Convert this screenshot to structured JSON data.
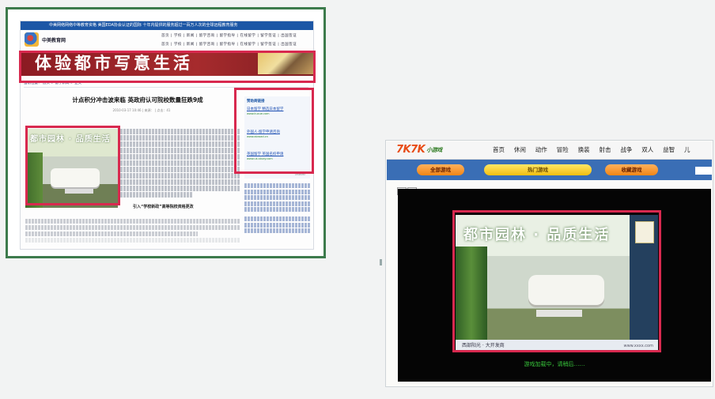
{
  "left": {
    "topbar_text": "中美网络网络中等教育资格 美国EDA协会认证的国际 十年内提供的服务超过一百万人次的全球远程教育服务",
    "logo_text": "中美教育网",
    "nav_rows": [
      "首页 | 学校 | 新闻 | 留学咨询 | 留学指导 | 在线留学 | 留学签证 | 出国签证",
      "首页 | 学校 | 新闻 | 留学咨询 | 留学指导 | 在线留学 | 留学签证 | 出国签证"
    ],
    "banner_text": "体验都市写意生活",
    "breadcrumb": "当前位置： 首页 > 留学新闻 > 正文",
    "article_title": "计点积分冲击波来临  英政府认可院校数量狂跌9成",
    "article_meta": "2010-03-17 10:46 | 来源： | 点击：41",
    "article_image_caption": "都市园林 · 品质生活",
    "subhead": "引入“学校新政”高等院校资格更改",
    "ad_box": {
      "header": "赞助商链接",
      "ads": [
        {
          "title": "日本留学 精选日本留学",
          "sub": "www.liuxue.com"
        },
        {
          "title": "外国人·留学申请咨询",
          "sub": "www.abroad.cn"
        },
        {
          "title": "英国留学 英国名校申请",
          "sub": "www.uk-study.com"
        }
      ],
      "footer": "投放推广"
    }
  },
  "right": {
    "logo_main": "7K7K",
    "logo_sub": "小游戏",
    "nav": [
      "首页",
      "休闲",
      "动作",
      "冒险",
      "换装",
      "射击",
      "战争",
      "双人",
      "益智",
      "儿"
    ],
    "buttons": {
      "all_games": "全部游戏",
      "hot": "热门游戏",
      "favorite": "收藏游戏"
    },
    "game_image_caption": "都市园林 · 品质生活",
    "game_image_bar": "西部阳光 · 大开发商",
    "game_image_url": "www.xxxx.com",
    "loading_text": "游戏加载中，请稍后……"
  },
  "colors": {
    "highlight": "#d8294f",
    "left_frame_border": "#3d7b4c",
    "banner_red": "#a62b2d",
    "blue_bar": "#3a6eb5",
    "loading_green": "#38c63b"
  }
}
